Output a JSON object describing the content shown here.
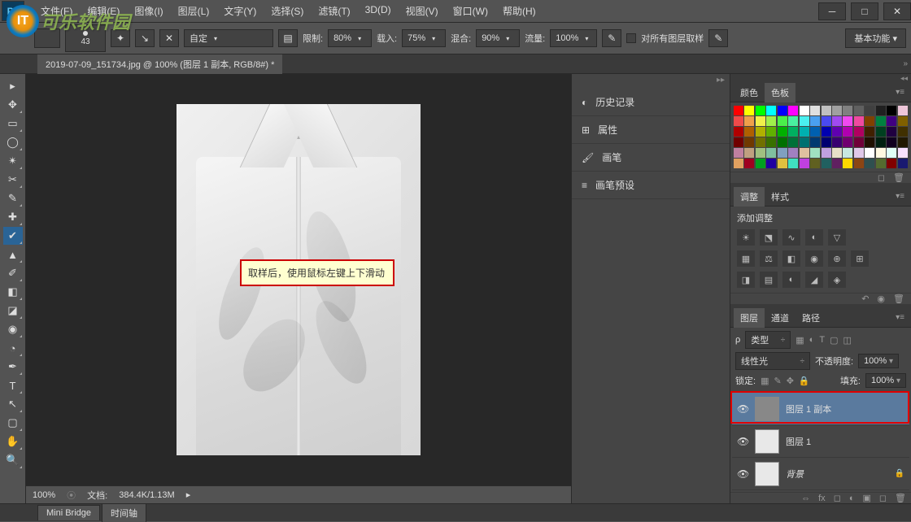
{
  "watermark_text": "可乐软件园",
  "menu": {
    "file": "文件(F)",
    "edit": "编辑(E)",
    "image": "图像(I)",
    "layer": "图层(L)",
    "type": "文字(Y)",
    "select": "选择(S)",
    "filter": "滤镜(T)",
    "3d": "3D(D)",
    "view": "视图(V)",
    "window": "窗口(W)",
    "help": "帮助(H)"
  },
  "options": {
    "brush_number": "43",
    "mode_zd": "自定",
    "limit_label": "限制:",
    "limit_val": "80%",
    "load_label": "载入:",
    "load_val": "75%",
    "mix_label": "混合:",
    "mix_val": "90%",
    "flow_label": "流量:",
    "flow_val": "100%",
    "sample_all": "对所有图层取样",
    "basic": "基本功能"
  },
  "doc_tab": "2019-07-09_151734.jpg @ 100% (图层 1 副本, RGB/8#) *",
  "tooltip": "取样后，使用鼠标左键上下滑动",
  "status": {
    "zoom": "100%",
    "doc_label": "文档:",
    "doc_size": "384.4K/1.13M"
  },
  "bottom_tabs": {
    "bridge": "Mini Bridge",
    "timeline": "时间轴"
  },
  "mid_panels": {
    "history": "历史记录",
    "properties": "属性",
    "brushes": "画笔",
    "brush_presets": "画笔预设"
  },
  "right": {
    "color_tab": "颜色",
    "swatch_tab": "色板",
    "adjust_tab": "调整",
    "styles_tab": "样式",
    "add_adjust": "添加调整",
    "layers_tab": "图层",
    "channels_tab": "通道",
    "paths_tab": "路径",
    "kind": "类型",
    "blend_mode": "线性光",
    "opacity_label": "不透明度:",
    "opacity_val": "100%",
    "lock_label": "锁定:",
    "fill_label": "填充:",
    "fill_val": "100%",
    "layers": [
      {
        "name": "图层 1 副本",
        "selected": true,
        "italic": false,
        "locked": false
      },
      {
        "name": "图层 1",
        "selected": false,
        "italic": false,
        "locked": false
      },
      {
        "name": "背景",
        "selected": false,
        "italic": true,
        "locked": true
      }
    ]
  },
  "swatches": [
    "#ff0000",
    "#ffff00",
    "#00ff00",
    "#00ffff",
    "#0000ff",
    "#ff00ff",
    "#ffffff",
    "#e0e0e0",
    "#c0c0c0",
    "#a0a0a0",
    "#808080",
    "#606060",
    "#404040",
    "#202020",
    "#000000",
    "#eec6d9",
    "#f04a4a",
    "#f0a04a",
    "#f0f04a",
    "#a0f04a",
    "#4af04a",
    "#4af0a0",
    "#4af0f0",
    "#4aa0f0",
    "#4a4af0",
    "#a04af0",
    "#f04af0",
    "#f04aa0",
    "#804000",
    "#008040",
    "#400080",
    "#806000",
    "#b00000",
    "#b06000",
    "#b0b000",
    "#60b000",
    "#00b000",
    "#00b060",
    "#00b0b0",
    "#0060b0",
    "#0000b0",
    "#6000b0",
    "#b000b0",
    "#b00060",
    "#402000",
    "#004020",
    "#200040",
    "#403000",
    "#700000",
    "#703800",
    "#707000",
    "#387000",
    "#007000",
    "#007038",
    "#007070",
    "#003870",
    "#000070",
    "#380070",
    "#700070",
    "#700038",
    "#201000",
    "#002010",
    "#100020",
    "#201800",
    "#c080a0",
    "#c0a080",
    "#a0c080",
    "#80c0a0",
    "#80a0c0",
    "#a080c0",
    "#e0c0a0",
    "#a0e0c0",
    "#c0a0e0",
    "#e8e0c8",
    "#c8e8e0",
    "#e0c8e8",
    "#ffffff",
    "#fff8e0",
    "#e0fff8",
    "#f8e0ff",
    "#e0a060",
    "#a00020",
    "#00a020",
    "#2000a0",
    "#e0c040",
    "#40e0c0",
    "#c040e0",
    "#606020",
    "#206060",
    "#602060",
    "#ffd700",
    "#8b4513",
    "#2f4f4f",
    "#556b2f",
    "#800000",
    "#191970"
  ]
}
